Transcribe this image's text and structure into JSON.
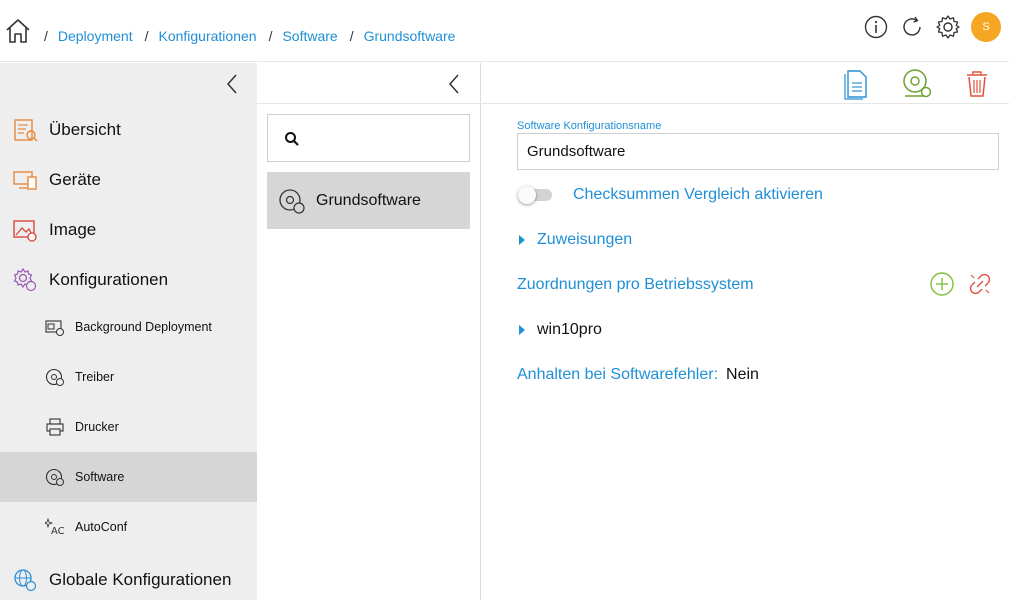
{
  "breadcrumb": {
    "items": [
      "Deployment",
      "Konfigurationen",
      "Software",
      "Grundsoftware"
    ],
    "separator": "/"
  },
  "header": {
    "user_initial": "S",
    "icons": [
      "info-icon",
      "refresh-icon",
      "gear-icon"
    ]
  },
  "sidebar": {
    "main_items": [
      {
        "label": "Übersicht",
        "icon": "overview-icon"
      },
      {
        "label": "Geräte",
        "icon": "devices-icon"
      },
      {
        "label": "Image",
        "icon": "image-icon"
      },
      {
        "label": "Konfigurationen",
        "icon": "configurations-icon"
      }
    ],
    "sub_items": [
      {
        "label": "Background Deployment",
        "icon": "background-deployment-icon"
      },
      {
        "label": "Treiber",
        "icon": "driver-icon"
      },
      {
        "label": "Drucker",
        "icon": "printer-icon"
      },
      {
        "label": "Software",
        "icon": "software-disc-icon",
        "active": true
      },
      {
        "label": "AutoConf",
        "icon": "autoconf-icon"
      }
    ],
    "bottom_item": {
      "label": "Globale Konfigurationen",
      "icon": "globe-gear-icon"
    }
  },
  "list": {
    "search_value": "",
    "items": [
      {
        "label": "Grundsoftware",
        "selected": true
      }
    ]
  },
  "detail": {
    "name_label": "Software Konfigurationsname",
    "name_value": "Grundsoftware",
    "checksum_label": "Checksummen Vergleich aktivieren",
    "checksum_enabled": false,
    "assignments_label": "Zuweisungen",
    "os_section_title": "Zuordnungen pro Betriebssystem",
    "os_items": [
      "win10pro"
    ],
    "halt_label": "Anhalten bei Softwarefehler:",
    "halt_value": "Nein"
  },
  "colors": {
    "accent": "#1f8fd6",
    "avatar": "#f5a623",
    "add": "#7dbe3c",
    "delete": "#e0513f",
    "sidebar_bg": "#eeeeee",
    "active_bg": "#d6d6d6"
  }
}
